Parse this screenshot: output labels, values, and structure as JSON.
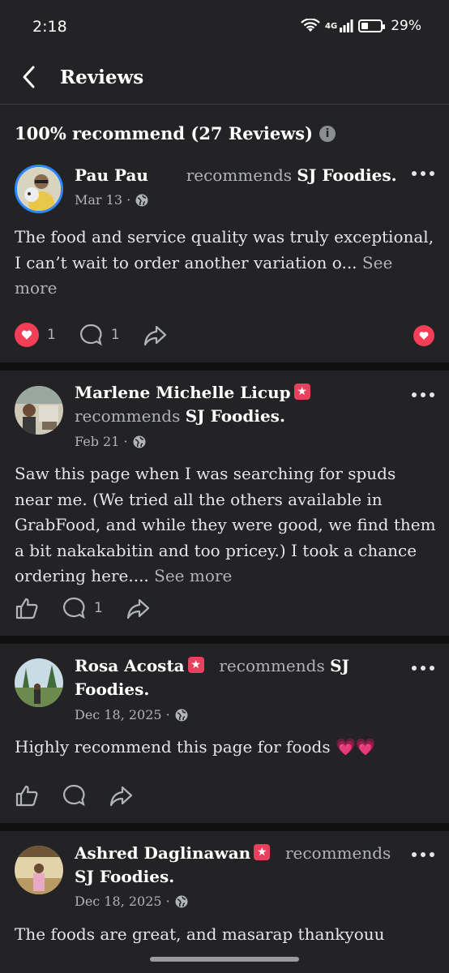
{
  "status": {
    "time": "2:18",
    "network": "4G",
    "battery": "29%"
  },
  "header": {
    "title": "Reviews"
  },
  "summary": {
    "text": "100% recommend (27 Reviews)",
    "info_glyph": "i"
  },
  "colors": {
    "background": "#232325",
    "separator": "#101011",
    "accent_heart": "#f33e58",
    "badge": "#e8405f",
    "muted": "#b0b3b8"
  },
  "reviews": [
    {
      "name": "Pau Pau",
      "recommends": "recommends",
      "page": "SJ Foodies.",
      "date": "Mar 13 ·",
      "text": "The food and service quality was truly exceptional, I can’t wait to order another variation o...",
      "see_more": "See more",
      "reactions": "1",
      "comments": "1"
    },
    {
      "name": "Marlene Michelle Licup",
      "recommends": "recommends",
      "page": "SJ Foodies.",
      "date": "Feb 21 ·",
      "text": "Saw this page when I was searching for spuds near me. (We tried all the others available in GrabFood, and while they were good, we find them a bit nakakabitin and too pricey.) I took a chance ordering here....",
      "see_more": "See more",
      "comments": "1"
    },
    {
      "name": "Rosa Acosta",
      "recommends": "recommends",
      "page": "SJ Foodies.",
      "date": "Dec 18, 2025 ·",
      "text": "Highly recommend this page for foods 💗💗"
    },
    {
      "name": "Ashred Daglinawan",
      "recommends": "recommends",
      "page": "SJ Foodies.",
      "date": "Dec 18, 2025 ·",
      "text": "The foods are great, and masarap thankyouu"
    }
  ]
}
